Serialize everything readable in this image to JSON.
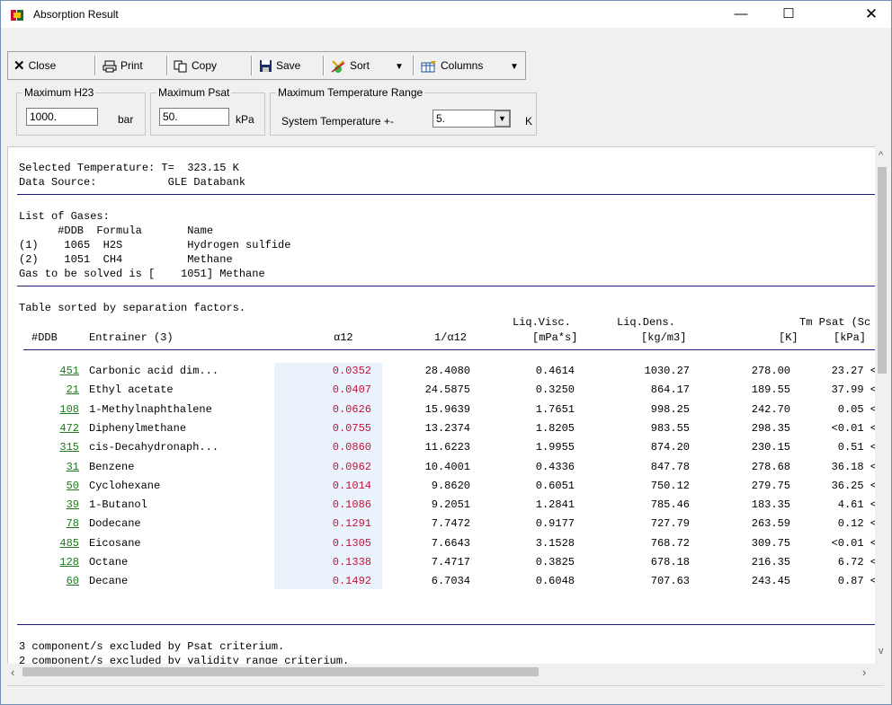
{
  "window": {
    "title": "Absorption Result"
  },
  "toolbar": {
    "close_label": "Close",
    "print_label": "Print",
    "copy_label": "Copy",
    "save_label": "Save",
    "sort_label": "Sort",
    "columns_label": "Columns"
  },
  "filters": {
    "h23": {
      "group_label": "Maximum H23",
      "value": "1000.",
      "unit": "bar"
    },
    "psat": {
      "group_label": "Maximum Psat",
      "value": "50.",
      "unit": "kPa"
    },
    "temp": {
      "group_label": "Maximum Temperature Range",
      "label": "System Temperature +-",
      "value": "5.",
      "unit": "K"
    }
  },
  "report": {
    "line1": "Selected Temperature: T=  323.15 K",
    "line2": "Data Source:           GLE Databank",
    "gases_title": "List of Gases:",
    "gases_header": "      #DDB  Formula       Name",
    "gas1": "(1)    1065  H2S          Hydrogen sulfide",
    "gas2": "(2)    1051  CH4          Methane",
    "gas_solved": "Gas to be solved is [    1051] Methane",
    "table_title": "Table sorted by separation factors.",
    "col_head_top": {
      "visc": "Liq.Visc.",
      "dens": "Liq.Dens.",
      "tm_psat": "Tm Psat (Sc"
    },
    "col_head": {
      "ddb": "#DDB",
      "entrainer": "Entrainer (3)",
      "a12": "α12",
      "inv_a12": "1/α12",
      "visc_unit": "[mPa*s]",
      "dens_unit": "[kg/m3]",
      "tm_unit": "[K]",
      "psat_unit": "[kPa]"
    },
    "rows": [
      {
        "ddb": "451",
        "name": "Carbonic acid dim...",
        "a12": "0.0352",
        "inv": "28.4080",
        "visc": "0.4614",
        "dens": "1030.27",
        "tm": "278.00",
        "psat": "23.27 <"
      },
      {
        "ddb": "21",
        "name": "Ethyl acetate",
        "a12": "0.0407",
        "inv": "24.5875",
        "visc": "0.3250",
        "dens": "864.17",
        "tm": "189.55",
        "psat": "37.99 <"
      },
      {
        "ddb": "108",
        "name": "1-Methylnaphthalene",
        "a12": "0.0626",
        "inv": "15.9639",
        "visc": "1.7651",
        "dens": "998.25",
        "tm": "242.70",
        "psat": "0.05 <"
      },
      {
        "ddb": "472",
        "name": "Diphenylmethane",
        "a12": "0.0755",
        "inv": "13.2374",
        "visc": "1.8205",
        "dens": "983.55",
        "tm": "298.35",
        "psat": "<0.01 <"
      },
      {
        "ddb": "315",
        "name": "cis-Decahydronaph...",
        "a12": "0.0860",
        "inv": "11.6223",
        "visc": "1.9955",
        "dens": "874.20",
        "tm": "230.15",
        "psat": "0.51 <"
      },
      {
        "ddb": "31",
        "name": "Benzene",
        "a12": "0.0962",
        "inv": "10.4001",
        "visc": "0.4336",
        "dens": "847.78",
        "tm": "278.68",
        "psat": "36.18 <"
      },
      {
        "ddb": "50",
        "name": "Cyclohexane",
        "a12": "0.1014",
        "inv": "9.8620",
        "visc": "0.6051",
        "dens": "750.12",
        "tm": "279.75",
        "psat": "36.25 <"
      },
      {
        "ddb": "39",
        "name": "1-Butanol",
        "a12": "0.1086",
        "inv": "9.2051",
        "visc": "1.2841",
        "dens": "785.46",
        "tm": "183.35",
        "psat": "4.61 <"
      },
      {
        "ddb": "78",
        "name": "Dodecane",
        "a12": "0.1291",
        "inv": "7.7472",
        "visc": "0.9177",
        "dens": "727.79",
        "tm": "263.59",
        "psat": "0.12 <"
      },
      {
        "ddb": "485",
        "name": "Eicosane",
        "a12": "0.1305",
        "inv": "7.6643",
        "visc": "3.1528",
        "dens": "768.72",
        "tm": "309.75",
        "psat": "<0.01 <"
      },
      {
        "ddb": "128",
        "name": "Octane",
        "a12": "0.1338",
        "inv": "7.4717",
        "visc": "0.3825",
        "dens": "678.18",
        "tm": "216.35",
        "psat": "6.72 <"
      },
      {
        "ddb": "60",
        "name": "Decane",
        "a12": "0.1492",
        "inv": "6.7034",
        "visc": "0.6048",
        "dens": "707.63",
        "tm": "243.45",
        "psat": "0.87 <"
      }
    ],
    "footer1": "3 component/s excluded by Psat criterium.",
    "footer2": "2 component/s excluded by validity range criterium."
  }
}
